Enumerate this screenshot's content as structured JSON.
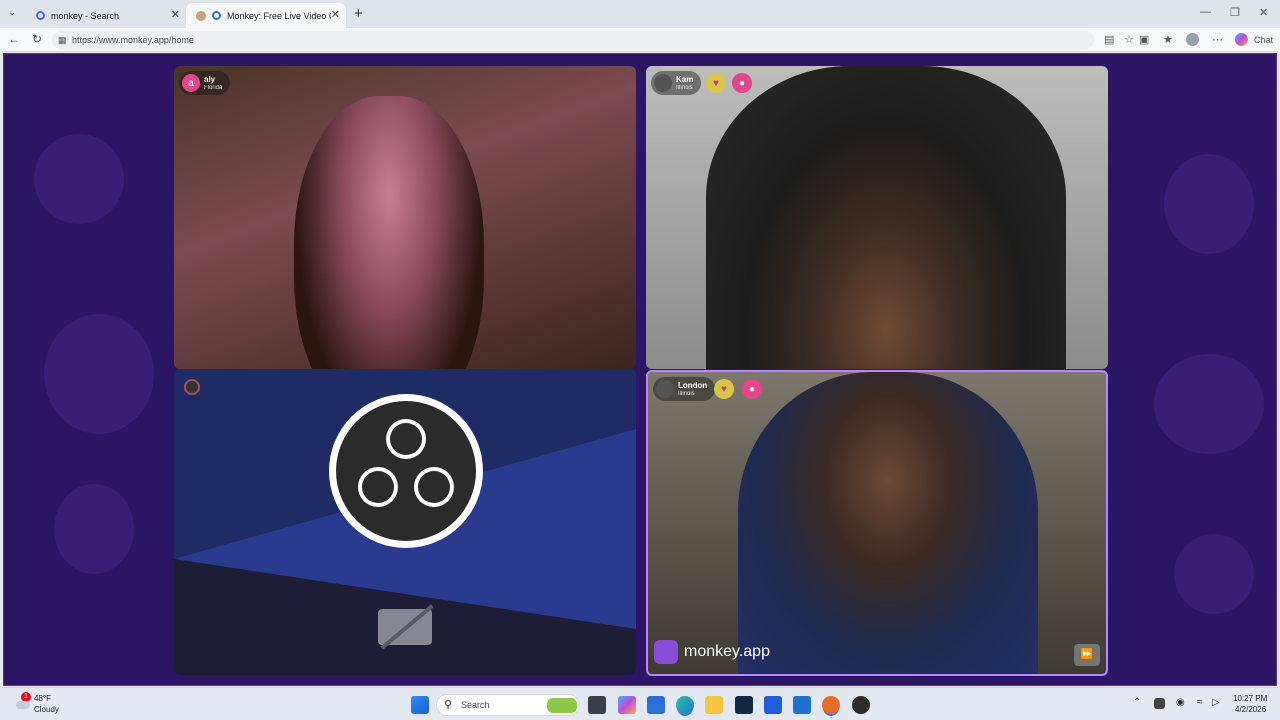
{
  "browser": {
    "tabs": [
      {
        "title": "monkey - Search",
        "icon": "search-icon"
      },
      {
        "title": "Monkey: Free Live Video Chat",
        "icon": "monkey-icon"
      }
    ],
    "new_tab": "+",
    "url": "https://www.monkey.app/home",
    "chat_label": "Chat"
  },
  "video": {
    "aly": {
      "initial": "a",
      "name": "aly",
      "location": "Florida"
    },
    "kam": {
      "name": "Kam",
      "location": "Illinois"
    },
    "london": {
      "name": "London",
      "location": "Illinois"
    },
    "brand": "monkey.app"
  },
  "taskbar": {
    "weather_temp": "48°F",
    "weather_desc": "Cloudy",
    "weather_badge": "1",
    "search_placeholder": "Search",
    "time": "10:27 PM",
    "date": "4/2/2026"
  },
  "colors": {
    "page_bg": "#2a1664",
    "accent": "#b985ff",
    "badge": "#e2458a"
  }
}
